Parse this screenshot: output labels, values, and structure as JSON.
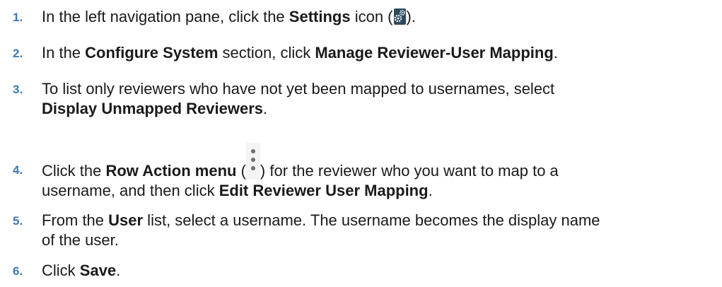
{
  "steps": [
    {
      "number": "1.",
      "t1": "In the left navigation pane, click the ",
      "b1": "Settings",
      "t2": " icon (",
      "icon": "settings-gear-icon",
      "t3": ")."
    },
    {
      "number": "2.",
      "t1": "In the ",
      "b1": "Configure System",
      "t2": " section, click ",
      "b2": "Manage Reviewer-User Mapping",
      "t3": "."
    },
    {
      "number": "3.",
      "t1": "To list only reviewers who have not yet been mapped to usernames, select",
      "b1": "Display Unmapped Reviewers",
      "t2": "."
    },
    {
      "number": "4.",
      "t1": "Click the ",
      "b1": "Row Action menu",
      "t2": " (",
      "icon": "kebab-menu-icon",
      "t3": ") for the reviewer who you want to map to a",
      "t4": "username, and then click ",
      "b2": "Edit Reviewer User Mapping",
      "t5": "."
    },
    {
      "number": "5.",
      "t1": "From the ",
      "b1": "User",
      "t2": " list, select a username. The username becomes the display name",
      "t3": "of the user."
    },
    {
      "number": "6.",
      "t1": "Click ",
      "b1": "Save",
      "t2": "."
    }
  ],
  "colors": {
    "step_number": "#3b78b4",
    "text": "#1a1a1a",
    "icon_bg": "#2d4a5e"
  }
}
